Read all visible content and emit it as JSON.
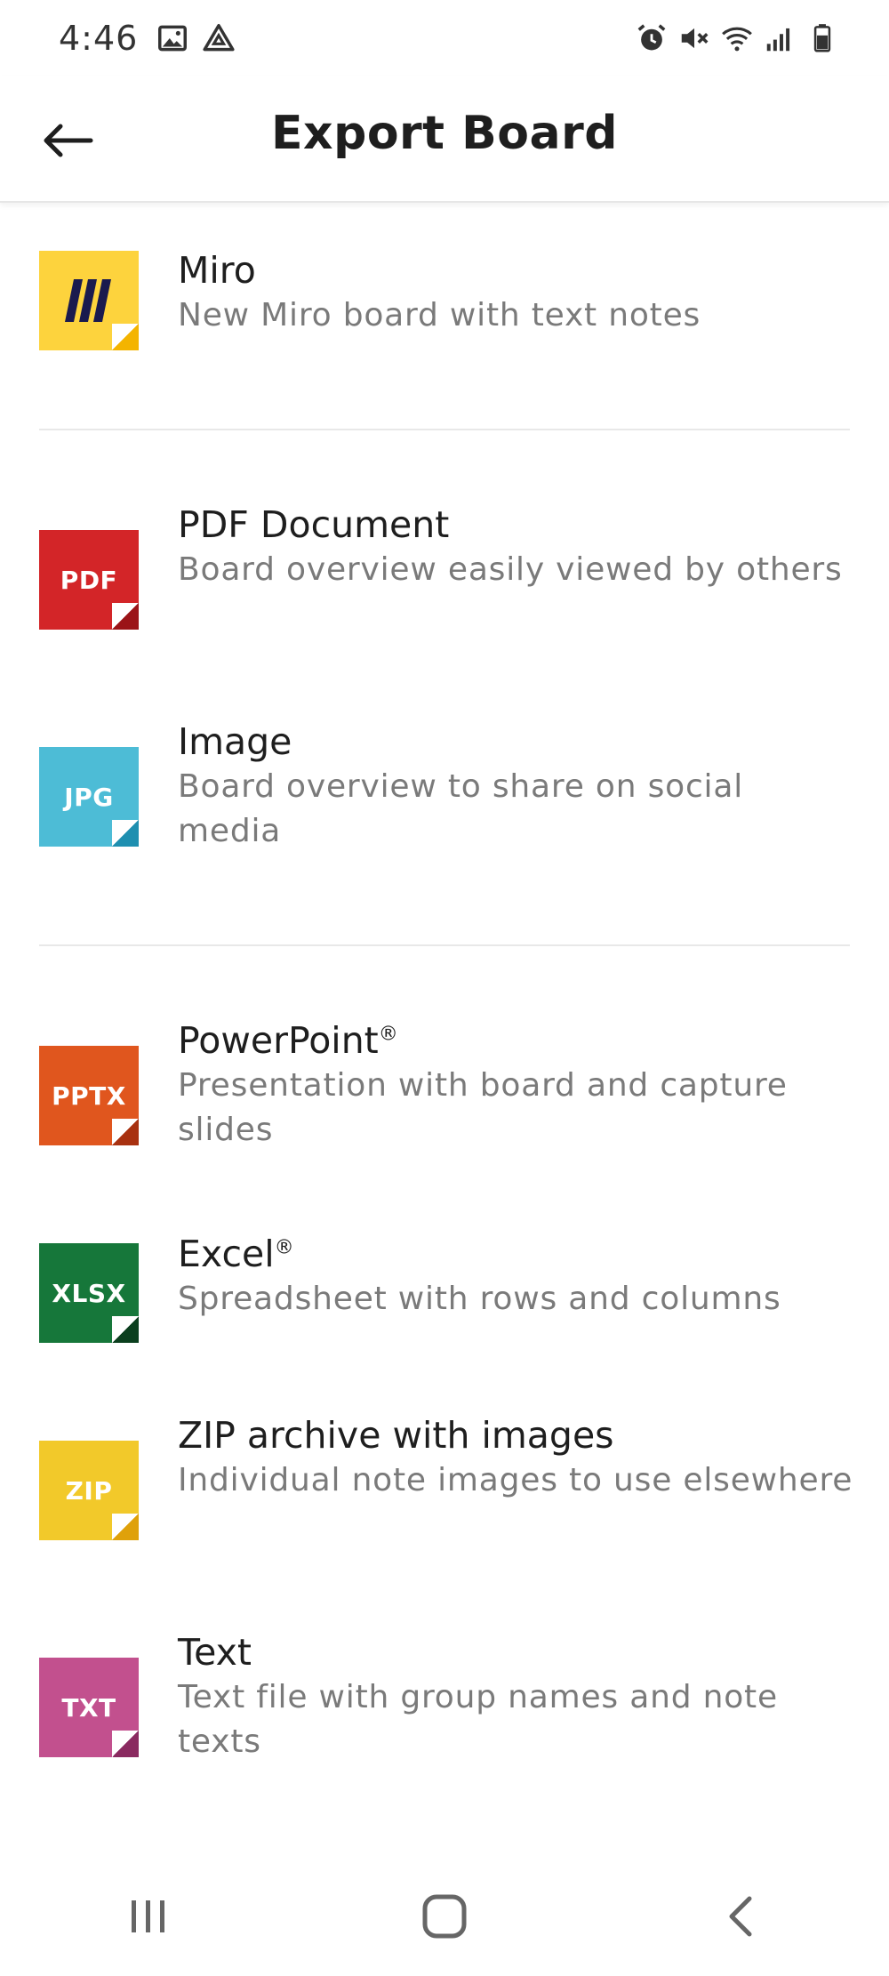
{
  "status_bar": {
    "time": "4:46",
    "left_icons": [
      "image-icon",
      "drive-icon"
    ],
    "right_icons": [
      "alarm-icon",
      "mute-icon",
      "wifi-icon",
      "signal-icon",
      "battery-icon"
    ]
  },
  "header": {
    "title": "Export Board",
    "back_icon": "arrow-left-icon"
  },
  "export_options": [
    {
      "id": "miro",
      "title": "Miro",
      "description": "New Miro board with text notes",
      "tile_label": "",
      "color": "#FDD33D",
      "fold_color": "#F4B400"
    },
    {
      "id": "pdf",
      "title": "PDF Document",
      "description": "Board overview easily viewed by others",
      "tile_label": "PDF",
      "color": "#D32528",
      "fold_color": "#9B1418"
    },
    {
      "id": "jpg",
      "title": "Image",
      "description": "Board overview to share on social media",
      "tile_label": "JPG",
      "color": "#4DBCD6",
      "fold_color": "#1E8FB0"
    },
    {
      "id": "pptx",
      "title": "PowerPoint",
      "title_mark": "®",
      "description": "Presentation with board and capture slides",
      "tile_label": "PPTX",
      "color": "#E0561E",
      "fold_color": "#A83110"
    },
    {
      "id": "xlsx",
      "title": "Excel",
      "title_mark": "®",
      "description": "Spreadsheet with rows and columns",
      "tile_label": "XLSX",
      "color": "#16773A",
      "fold_color": "#0B3F1E"
    },
    {
      "id": "zip",
      "title": "ZIP archive with images",
      "description": "Individual note images to use elsewhere",
      "tile_label": "ZIP",
      "color": "#F2C92A",
      "fold_color": "#DFA10A"
    },
    {
      "id": "txt",
      "title": "Text",
      "description": "Text file with group names and note texts",
      "tile_label": "TXT",
      "color": "#C2508E",
      "fold_color": "#8A2A60"
    }
  ],
  "nav_bar": {
    "icons": [
      "recent-apps-icon",
      "home-icon",
      "back-icon"
    ]
  }
}
